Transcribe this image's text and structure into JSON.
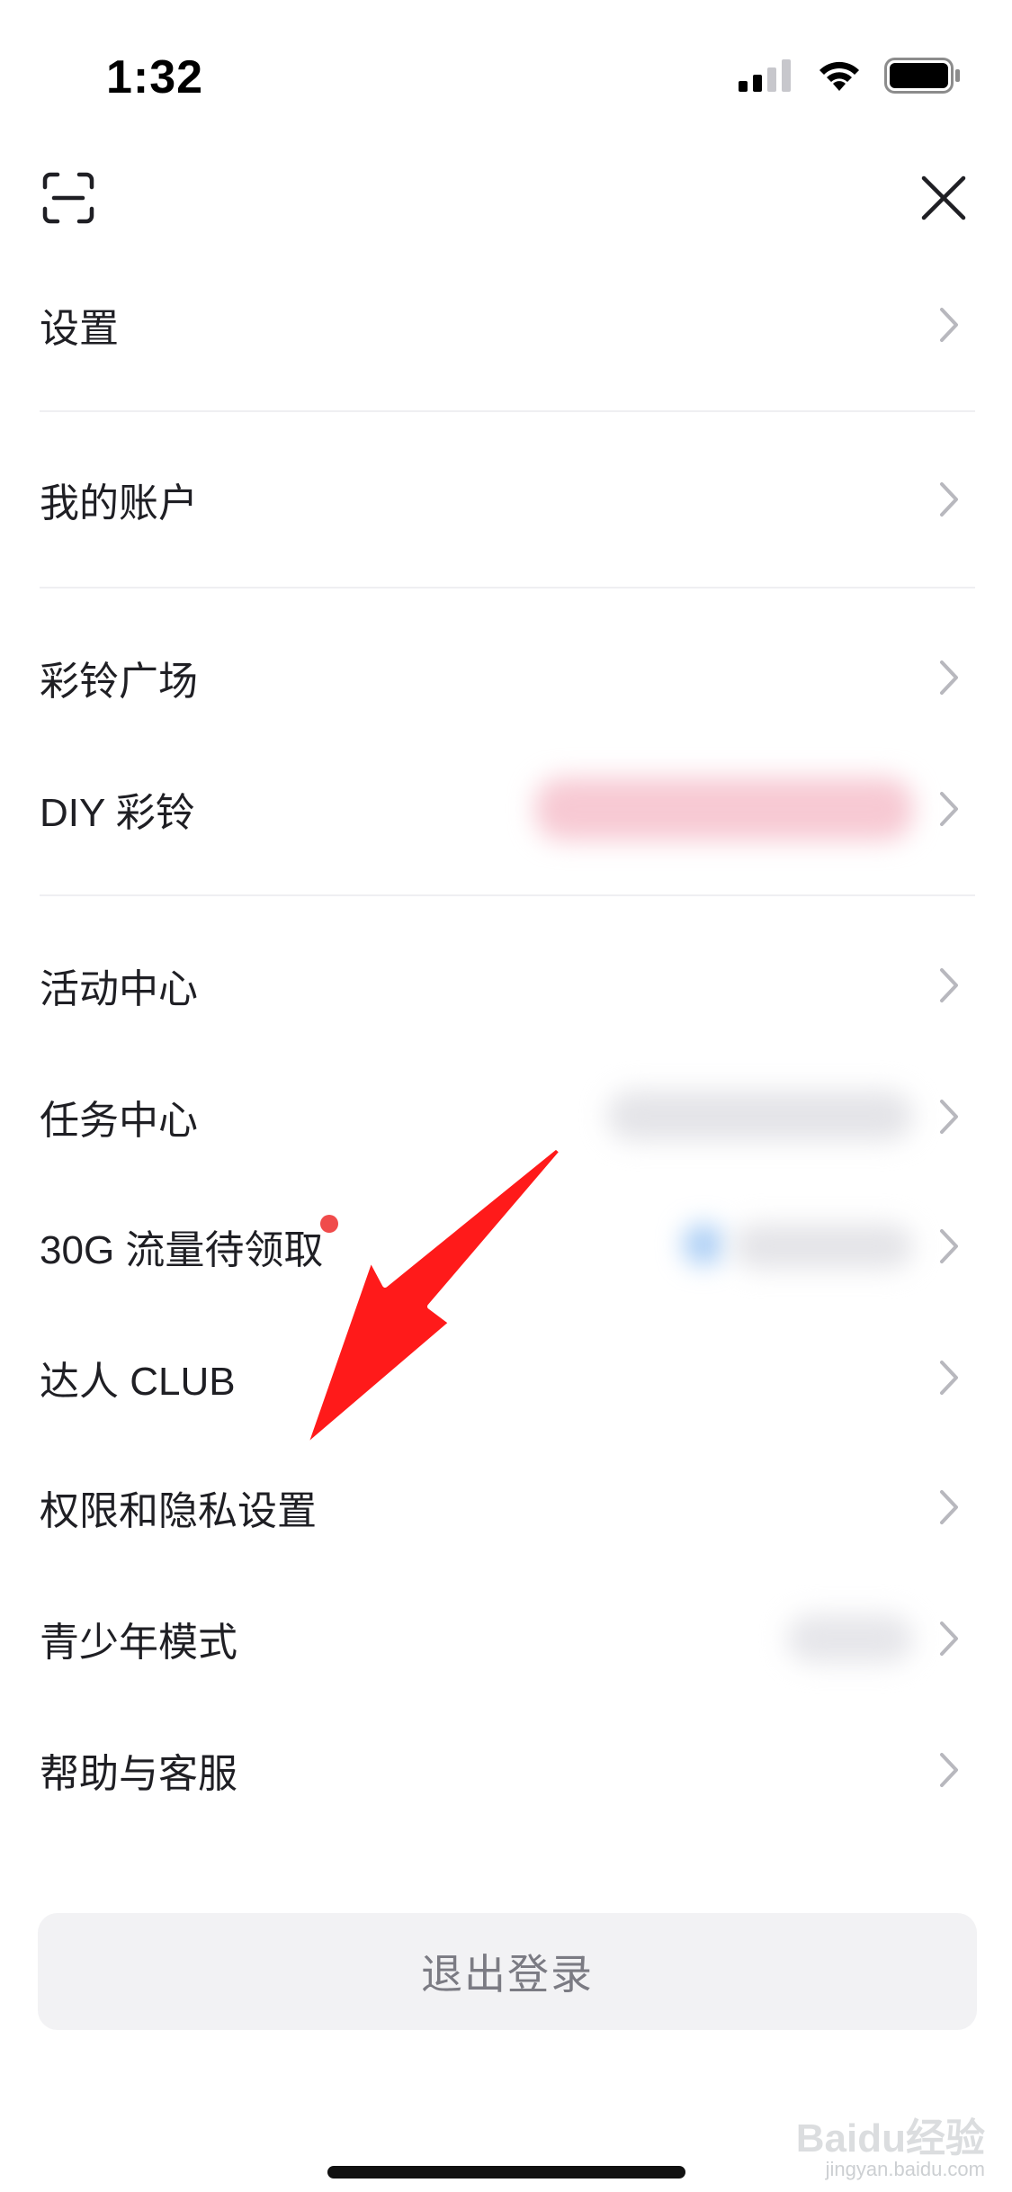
{
  "status_bar": {
    "time": "1:32",
    "icons": [
      "cellular-signal-icon",
      "wifi-icon",
      "battery-icon"
    ]
  },
  "topbar": {
    "left_icon": "scan-icon",
    "right_icon": "close-icon"
  },
  "menu": {
    "items": [
      {
        "label": "设置",
        "key": "settings"
      },
      {
        "label": "我的账户",
        "key": "my-account"
      },
      {
        "label": "彩铃广场",
        "key": "ringback-plaza"
      },
      {
        "label": "DIY 彩铃",
        "key": "diy-ringback"
      },
      {
        "label": "活动中心",
        "key": "activity-center"
      },
      {
        "label": "任务中心",
        "key": "task-center"
      },
      {
        "label": "30G 流量待领取",
        "key": "data-bonus",
        "badge": "red-dot"
      },
      {
        "label": "达人 CLUB",
        "key": "expert-club"
      },
      {
        "label": "权限和隐私设置",
        "key": "permissions-privacy"
      },
      {
        "label": "青少年模式",
        "key": "youth-mode"
      },
      {
        "label": "帮助与客服",
        "key": "help-service"
      }
    ]
  },
  "logout": {
    "label": "退出登录"
  },
  "watermark": {
    "text": "Baidu经验",
    "sub": "jingyan.baidu.com"
  },
  "colors": {
    "text": "#1f1f24",
    "chevron": "#b8b8be",
    "divider": "#efeff2",
    "logout_bg": "#f2f2f4",
    "logout_text": "#7b7b83",
    "badge": "#f04b4b",
    "annotation_arrow": "#ff1a1a"
  }
}
